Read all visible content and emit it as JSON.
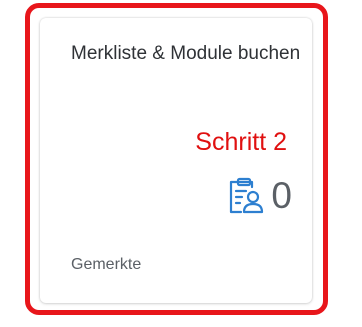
{
  "tile": {
    "title": "Merkliste & Module buchen",
    "step_label": "Schritt 2",
    "kpi_value": "0",
    "kpi_icon": "clipboard-person-icon",
    "footer": "Gemerkte"
  },
  "colors": {
    "highlight_border": "#e8161b",
    "step_label": "#e01010",
    "icon_blue": "#2d7fd0",
    "text_primary": "#2f3236",
    "text_secondary": "#5b6066"
  }
}
